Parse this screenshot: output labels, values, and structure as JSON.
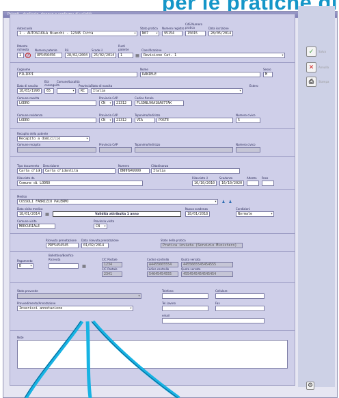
{
  "banner": {
    "text": "per le pratiche di"
  },
  "window": {
    "title": "Patenti - duplicato, rinnovo e conferma di validità"
  },
  "auto": {
    "label_autoscuola": "Autoscuola",
    "autoscuola": "1 - AUTOSCUOLA Bianchi - 12345 Città",
    "label_stato": "Stato pratica",
    "stato": "N07",
    "label_registro": "Numero registro",
    "registro": "95154",
    "label_prot": "CdS Numero pratica",
    "prot": "15015",
    "label_data": "Data iscrizione",
    "data": "28/05/2014"
  },
  "pat": {
    "label_pat": "Patente richiesta",
    "pat": "1",
    "label_num": "Numero patente",
    "num": "UP5456456",
    "label_ril": "Ril.",
    "ril": "28/02/2004",
    "label_scad": "Scade il",
    "scad": "25/02/2014",
    "label_pun": "Punti patente",
    "pun": "1",
    "label_cls": "Classificazione",
    "cls": "Revisione Cat. 1"
  },
  "anag": {
    "label_cogn": "Cognome",
    "cogn": "FILIPPI",
    "label_nome": "Nome",
    "nome": "DANIELE",
    "label_sesso": "Sesso",
    "sesso": "M",
    "label_nasc": "Data di nascita",
    "nasc": "18/03/1990",
    "label_com": "Età conseguita",
    "com": "65",
    "label_loc": "Comune/Località",
    "loc": "",
    "label_pr": "Provincia",
    "pr": "RC",
    "label_ni": "Stato di nascita",
    "ni": "Italia",
    "label_estero": "Estero",
    "label_comres": "Comune nascita",
    "comres": "LODRO",
    "label_cap": "Provincia CAP",
    "prcap": "CN",
    "cap": "21312",
    "label_cf": "Codice fiscale",
    "cf": "FLSDNL90A18A877AK"
  },
  "res": {
    "label_com": "Comune residenza",
    "com": "LODRO",
    "label_cap": "Provincia CAP",
    "pr": "CN",
    "cap": "21312",
    "label_ind": "Toponimo/Indirizzo",
    "top": "VIA",
    "ind": "POSTE",
    "label_civ": "Numero civico",
    "civ": "5"
  },
  "rec": {
    "label_rec": "Recapito della patente",
    "rec": "Recapito a domicilio",
    "label_com": "Comune recapito",
    "label_cap": "Provincia CAP",
    "label_ind": "Toponimo/Indirizzo",
    "label_civ": "Numero civico"
  },
  "doc": {
    "label_tipo": "Tipo documento",
    "tipo": "Carta d'id",
    "label_desc": "Descrizione",
    "desc": "Carta d'identità",
    "label_num": "Numero",
    "num": "BNHH949999",
    "label_citt": "Cittadinanza",
    "citt": "Italia",
    "label_ril": "Rilasciato da",
    "ril": "Comune di LODRO",
    "label_rilil": "Rilasciato il",
    "rilil": "16/10/2010",
    "label_scad": "Scadenza",
    "scad": "16/10/2020",
    "label_altezza": "Altezza",
    "label_peso": "Peso"
  },
  "med": {
    "label_med": "Medico",
    "med": "COSSOLI FABRIZIO PALERMO",
    "label_visita": "Data visita medica",
    "visita": "18/01/2014",
    "validita": "Validità attribuita 1 anno",
    "label_nuovascad": "Nuova scadenza",
    "nuovascad": "18/01/2018",
    "label_cond": "Condizioni",
    "cond": "Normale",
    "label_comvis": "Comune visita",
    "comvis": "MERCURIALE",
    "label_prvis": "Provincia visita",
    "prvis": "CN"
  },
  "pre": {
    "label_ricev": "Ricevuta prenotazione",
    "ricev": "PRF5454545",
    "label_datapr": "Data ricevuta prenotazione",
    "datapr": "01/02/2014",
    "label_stato": "Stato della pratica",
    "stato": "Pratica inviata (Servizio Ministero)"
  },
  "pag": {
    "label_pag": "Pagamento",
    "pag": "B",
    "label_cb": "Bollettino/Bonifico",
    "label_cb2": "Ricevuta",
    "cb": "",
    "label_cc1": "C/C Postale",
    "cc1": "1234",
    "label_cod1": "Codice controllo",
    "cod1": "A4455665554",
    "label_q1": "Quota versata",
    "q1": "4455665545454555",
    "label_cc2": "C/C Postale",
    "cc2": "2341",
    "label_cod2": "Codice controllo",
    "cod2": "54645454555",
    "label_q2": "Quota versata",
    "q2": "4554545454545454"
  },
  "extra": {
    "label_dest": "Stato provvede",
    "dest": "",
    "label_pass": "Provvedimento/Annotazione",
    "pass": "Inserisci annotazione",
    "label_tel": "Telefono",
    "label_cell": "Cellulare",
    "label_tel2": "Tel.Lavoro",
    "label_fax": "Fax",
    "label_email": "email"
  },
  "note": {
    "label": "Note"
  },
  "side": {
    "save": "Salva",
    "cancel": "Annulla",
    "print": "Stampa"
  }
}
